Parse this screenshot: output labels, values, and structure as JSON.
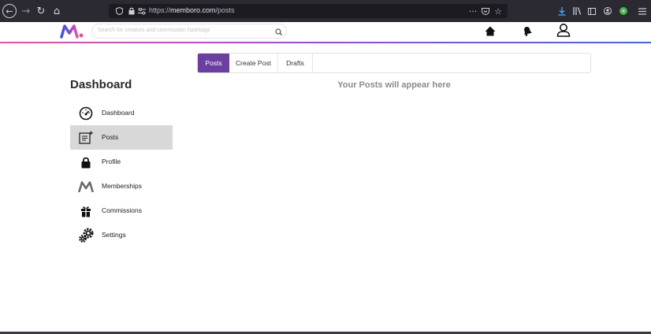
{
  "browser": {
    "url_prefix": "https://",
    "url_host": "memboro.com",
    "url_path": "/posts",
    "icons": [
      "back-icon",
      "forward-icon",
      "reload-icon",
      "home-icon",
      "shield-icon",
      "lock-icon",
      "permissions-icon",
      "more-icon",
      "pocket-icon",
      "bookmark-star-icon",
      "download-icon",
      "library-icon",
      "sidebar-icon",
      "account-icon",
      "extension-icon",
      "menu-icon"
    ]
  },
  "site": {
    "search_placeholder": "Search for creators and commission hashtags",
    "header_icons": [
      "home-icon",
      "bell-icon",
      "user-icon"
    ],
    "brand_colors": {
      "pink": "#e0559a",
      "purple": "#9a4fd2",
      "blue": "#4a63d9",
      "tab_active": "#6a3fa0"
    }
  },
  "tabs": [
    {
      "label": "Posts",
      "active": true
    },
    {
      "label": "Create Post",
      "active": false
    },
    {
      "label": "Drafts",
      "active": false
    }
  ],
  "main": {
    "empty_message": "Your Posts will appear here"
  },
  "sidebar": {
    "title": "Dashboard",
    "items": [
      {
        "label": "Dashboard",
        "icon": "speedometer-icon",
        "active": false
      },
      {
        "label": "Posts",
        "icon": "posts-icon",
        "active": true
      },
      {
        "label": "Profile",
        "icon": "lock-icon",
        "active": false
      },
      {
        "label": "Memberships",
        "icon": "memberships-icon",
        "active": false
      },
      {
        "label": "Commissions",
        "icon": "gift-icon",
        "active": false
      },
      {
        "label": "Settings",
        "icon": "gears-icon",
        "active": false
      }
    ]
  }
}
